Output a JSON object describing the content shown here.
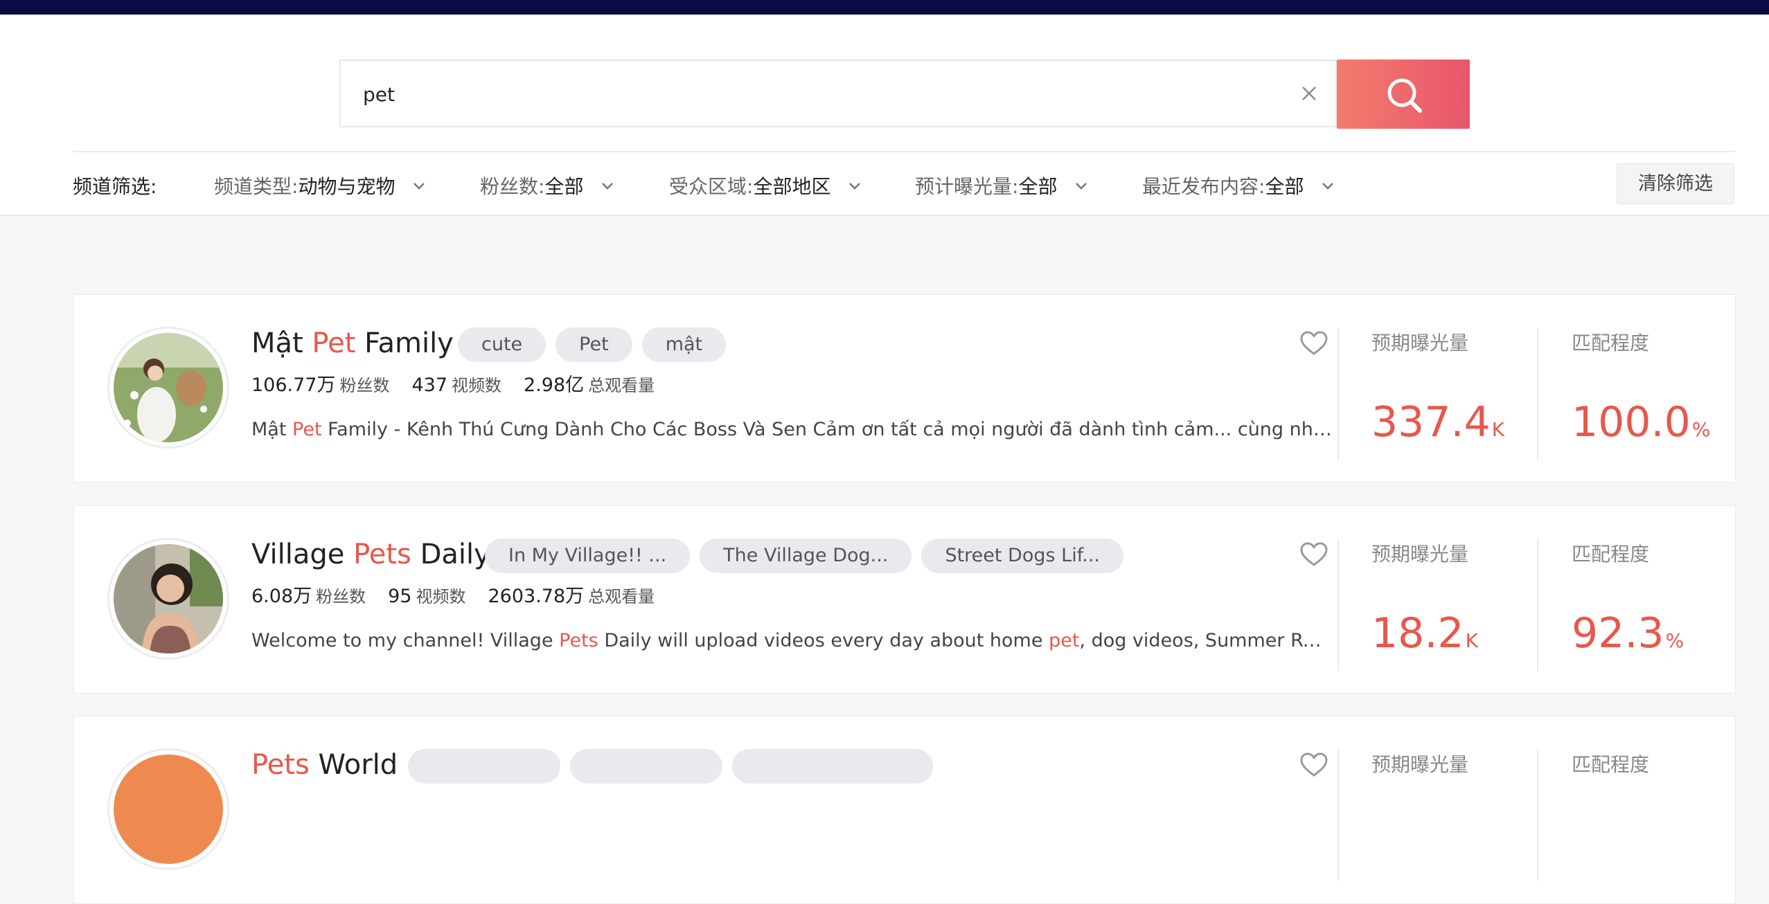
{
  "search": {
    "value": "pet"
  },
  "filters": {
    "title": "频道筛选:",
    "items": [
      {
        "label": "频道类型:",
        "value": "动物与宠物"
      },
      {
        "label": "粉丝数:",
        "value": "全部"
      },
      {
        "label": "受众区域:",
        "value": "全部地区"
      },
      {
        "label": "预计曝光量:",
        "value": "全部"
      },
      {
        "label": "最近发布内容:",
        "value": "全部"
      }
    ],
    "clear_label": "清除筛选"
  },
  "channels": [
    {
      "name_pre": "Mật ",
      "name_hl": "Pet",
      "name_post": " Family",
      "tags": [
        "cute",
        "Pet",
        "mật"
      ],
      "followers": "106.77万",
      "followers_label": "粉丝数",
      "videos": "437",
      "videos_label": "视频数",
      "views": "2.98亿",
      "views_label": "总观看量",
      "desc_1": "Mật ",
      "desc_hl1": "Pet",
      "desc_2": " Family - Kênh Thú Cưng Dành Cho Các Boss Và Sen Cảm ơn tất cả mọi người đã dành tình cảm... cùng nhau tạo th...",
      "desc_hl2": "",
      "desc_3": "",
      "exposure_label": "预期曝光量",
      "exposure_value": "337.4",
      "exposure_unit": "K",
      "match_label": "匹配程度",
      "match_value": "100.0",
      "match_unit": "%"
    },
    {
      "name_pre": "Village ",
      "name_hl": "Pets",
      "name_post": " Daily",
      "tags": [
        "In My Village!! ...",
        "The Village Dog...",
        "Street Dogs Lif..."
      ],
      "followers": "6.08万",
      "followers_label": "粉丝数",
      "videos": "95",
      "videos_label": "视频数",
      "views": "2603.78万",
      "views_label": "总观看量",
      "desc_1": "Welcome to my channel! Village ",
      "desc_hl1": "Pets",
      "desc_2": " Daily will upload videos every day about home ",
      "desc_hl2": "pet",
      "desc_3": ", dog videos, Summer RuralDogs, Ha...",
      "exposure_label": "预期曝光量",
      "exposure_value": "18.2",
      "exposure_unit": "K",
      "match_label": "匹配程度",
      "match_value": "92.3",
      "match_unit": "%"
    },
    {
      "name_pre": "",
      "name_hl": "Pets",
      "name_post": " World",
      "exposure_label": "预期曝光量",
      "match_label": "匹配程度"
    }
  ],
  "colors": {
    "accent": "#e8574b",
    "topbar": "#0d0b45"
  }
}
